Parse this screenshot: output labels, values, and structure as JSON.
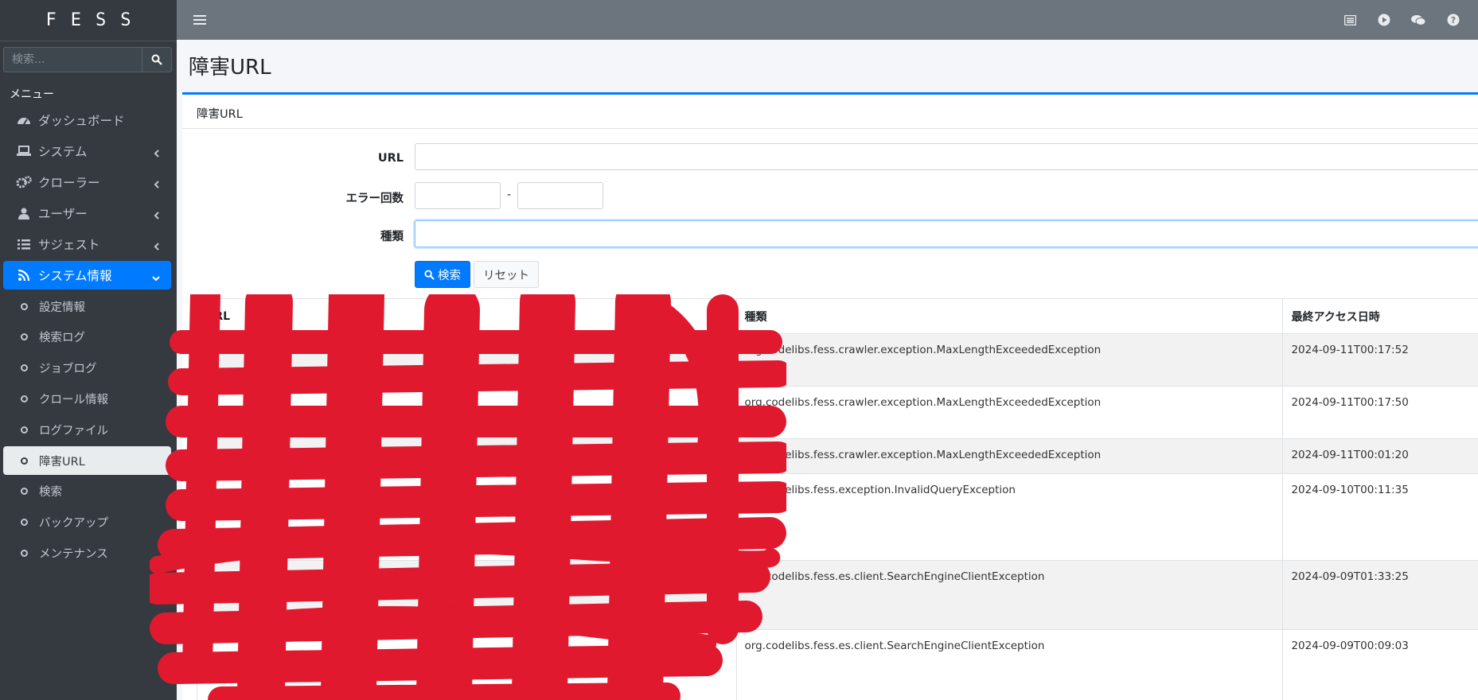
{
  "brand": "FESS",
  "sidebar": {
    "search_placeholder": "検索...",
    "menu_header": "メニュー",
    "items": [
      {
        "label": "ダッシュボード",
        "icon": "dashboard-icon"
      },
      {
        "label": "システム",
        "icon": "laptop-icon"
      },
      {
        "label": "クローラー",
        "icon": "cogs-icon"
      },
      {
        "label": "ユーザー",
        "icon": "user-icon"
      },
      {
        "label": "サジェスト",
        "icon": "list-icon"
      },
      {
        "label": "システム情報",
        "icon": "rss-icon"
      }
    ],
    "sub_items": [
      {
        "label": "設定情報"
      },
      {
        "label": "検索ログ"
      },
      {
        "label": "ジョブログ"
      },
      {
        "label": "クロール情報"
      },
      {
        "label": "ログファイル"
      },
      {
        "label": "障害URL"
      },
      {
        "label": "検索"
      },
      {
        "label": "バックアップ"
      },
      {
        "label": "メンテナンス"
      }
    ]
  },
  "page": {
    "title": "障害URL",
    "card_title": "障害URL"
  },
  "form": {
    "url_label": "URL",
    "error_count_label": "エラー回数",
    "range_separator": "-",
    "type_label": "種類",
    "search_button": "検索",
    "reset_button": "リセット"
  },
  "table": {
    "headers": [
      "URL",
      "種類",
      "最終アクセス日時"
    ],
    "rows": [
      {
        "url": "",
        "type": "org.codelibs.fess.crawler.exception.MaxLengthExceededException",
        "time": "2024-09-11T00:17:52"
      },
      {
        "url": "",
        "type": "org.codelibs.fess.crawler.exception.MaxLengthExceededException",
        "time": "2024-09-11T00:17:50"
      },
      {
        "url": "",
        "type": "org.codelibs.fess.crawler.exception.MaxLengthExceededException",
        "time": "2024-09-11T00:01:20"
      },
      {
        "url": "",
        "type": "org.codelibs.fess.exception.InvalidQueryException",
        "time": "2024-09-10T00:11:35"
      },
      {
        "url": "",
        "type": "org.codelibs.fess.es.client.SearchEngineClientException",
        "time": "2024-09-09T01:33:25"
      },
      {
        "url": "",
        "type": "org.codelibs.fess.es.client.SearchEngineClientException",
        "time": "2024-09-09T00:09:03"
      }
    ]
  },
  "colors": {
    "sidebar_bg": "#343a40",
    "topbar_bg": "#6c757d",
    "accent": "#007bff",
    "redaction": "#e0192f"
  }
}
